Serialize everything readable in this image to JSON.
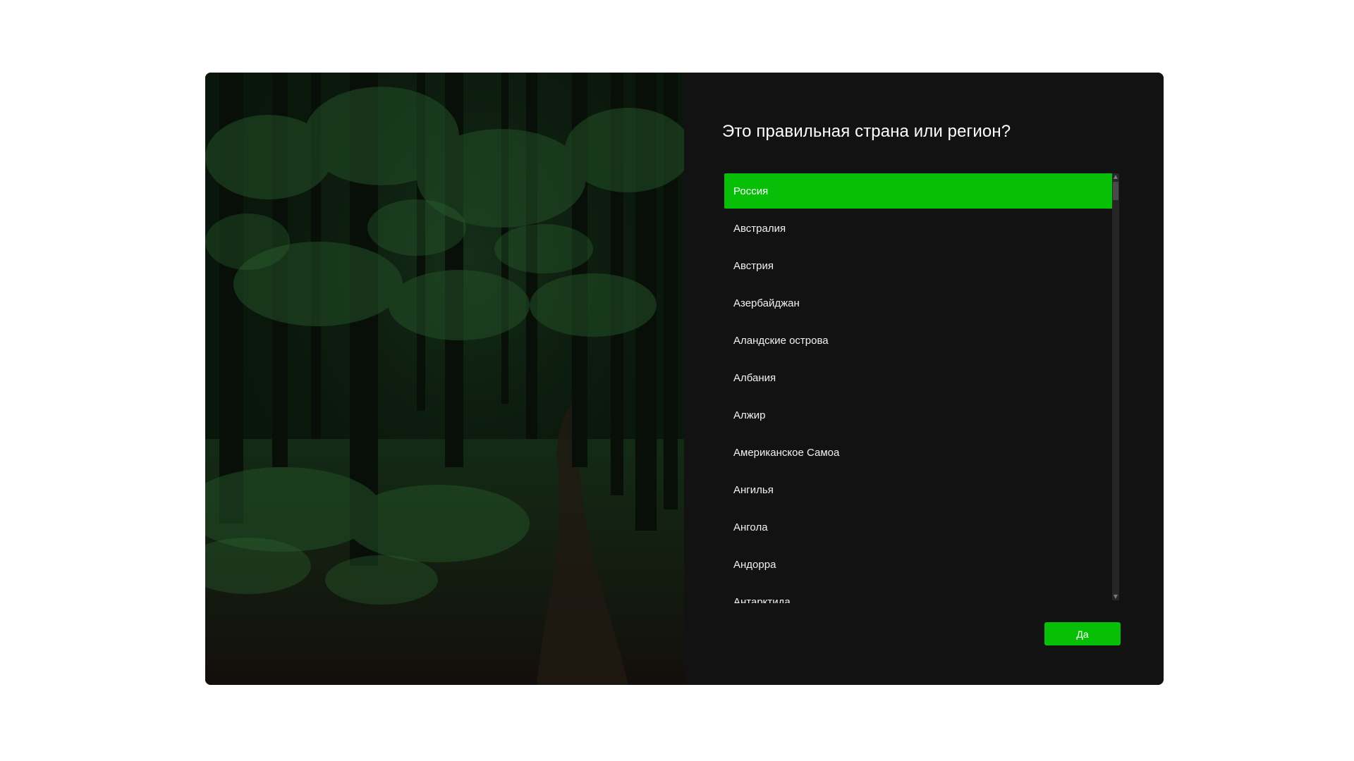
{
  "dialog": {
    "title": "Это правильная страна или регион?",
    "countries": [
      {
        "label": "Россия",
        "selected": true
      },
      {
        "label": "Австралия",
        "selected": false
      },
      {
        "label": "Австрия",
        "selected": false
      },
      {
        "label": "Азербайджан",
        "selected": false
      },
      {
        "label": "Аландские острова",
        "selected": false
      },
      {
        "label": "Албания",
        "selected": false
      },
      {
        "label": "Алжир",
        "selected": false
      },
      {
        "label": "Американское Самоа",
        "selected": false
      },
      {
        "label": "Ангилья",
        "selected": false
      },
      {
        "label": "Ангола",
        "selected": false
      },
      {
        "label": "Андорра",
        "selected": false
      },
      {
        "label": "Антарктида",
        "selected": false
      }
    ],
    "yes_button_label": "Да"
  },
  "icons": {
    "scroll_up": "chevron-up-icon",
    "scroll_down": "chevron-down-icon"
  },
  "colors": {
    "accent": "#07bf07",
    "panel_background": "#121212",
    "text": "#ffffff"
  }
}
